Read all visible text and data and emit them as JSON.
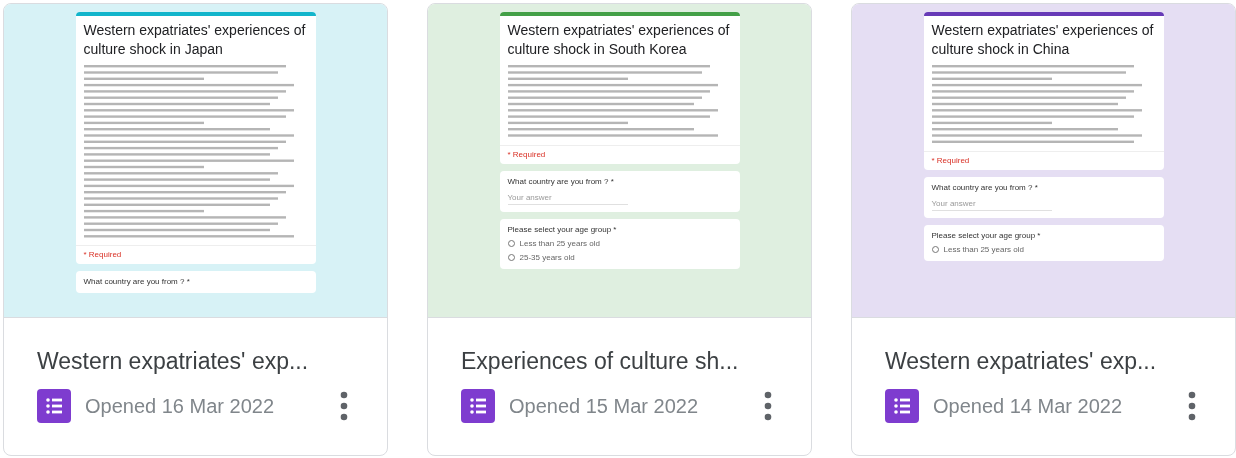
{
  "cards": [
    {
      "title": "Western expatriates' exp...",
      "opened": "Opened 16 Mar 2022",
      "color": "#12b5cb",
      "preview": {
        "title": "Western expatriates' experiences of culture shock in Japan",
        "required": "* Required",
        "questions": [
          {
            "kind": "text",
            "label": "What country are you from ? *"
          }
        ]
      }
    },
    {
      "title": "Experiences of culture sh...",
      "opened": "Opened 15 Mar 2022",
      "color": "#43a047",
      "preview": {
        "title": "Western expatriates' experiences of culture shock in South Korea",
        "required": "* Required",
        "questions": [
          {
            "kind": "text",
            "label": "What country are you from ? *",
            "placeholder": "Your answer"
          },
          {
            "kind": "choice",
            "label": "Please select your age group *",
            "options": [
              {
                "label": "Less than 25 years old",
                "selected": false
              },
              {
                "label": "25-35 years old",
                "selected": false
              }
            ]
          }
        ]
      }
    },
    {
      "title": "Western expatriates' exp...",
      "opened": "Opened 14 Mar 2022",
      "color": "#673ab7",
      "preview": {
        "title": "Western expatriates' experiences of culture shock in China",
        "required": "* Required",
        "questions": [
          {
            "kind": "text",
            "label": "What country are you from ? *",
            "placeholder": "Your answer"
          },
          {
            "kind": "choice",
            "label": "Please select your age group *",
            "options": [
              {
                "label": "Less than 25 years old",
                "selected": false
              }
            ]
          }
        ]
      }
    }
  ]
}
